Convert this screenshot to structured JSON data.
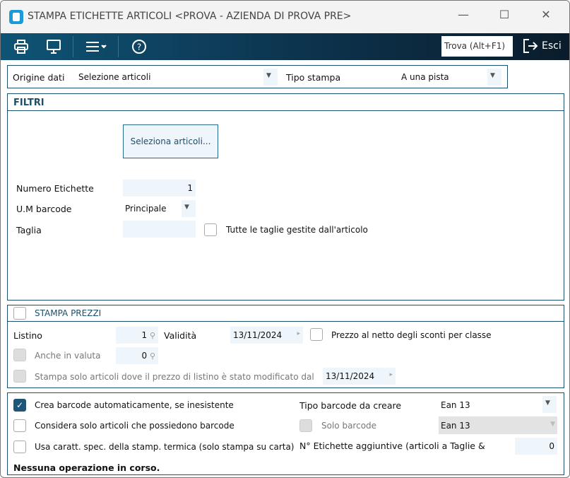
{
  "window": {
    "title": "STAMPA ETICHETTE ARTICOLI <PROVA - AZIENDA DI PROVA PRE>",
    "minimize": "—",
    "maximize": "☐",
    "close": "✕"
  },
  "toolbar": {
    "find_label": "Trova (Alt+F1)",
    "exit_label": "Esci"
  },
  "top": {
    "origine_label": "Origine dati",
    "origine_value": "Selezione articoli",
    "tipo_label": "Tipo stampa",
    "tipo_value": "A una pista"
  },
  "filtri": {
    "title": "FILTRI",
    "select_button": "Seleziona articoli...",
    "numero_label": "Numero Etichette",
    "numero_value": "1",
    "um_label": "U.M barcode",
    "um_value": "Principale",
    "taglia_label": "Taglia",
    "taglia_value": "",
    "tutte_label": "Tutte le taglie gestite dall'articolo"
  },
  "prezzi": {
    "title": "STAMPA PREZZI",
    "listino_label": "Listino",
    "listino_value": "1",
    "validita_label": "Validità",
    "validita_value": "13/11/2024",
    "netto_label": "Prezzo al netto degli sconti per classe",
    "valuta_label": "Anche in valuta",
    "valuta_value": "0",
    "modificato_label": "Stampa solo articoli dove il prezzo di listino è stato modificato dal",
    "modificato_value": "13/11/2024"
  },
  "barcode": {
    "crea_label": "Crea barcode automaticamente, se inesistente",
    "crea_checked": true,
    "considera_label": "Considera solo articoli che possiedono barcode",
    "usa_label": "Usa caratt. spec. della stamp. termica (solo stampa su carta)",
    "tipo_label": "Tipo barcode da creare",
    "tipo_value": "Ean 13",
    "solo_label": "Solo barcode",
    "solo_value": "Ean 13",
    "aggiuntive_label": "N° Etichette aggiuntive (articoli a Taglie &",
    "aggiuntive_value": "0"
  },
  "status": "Nessuna operazione in corso."
}
